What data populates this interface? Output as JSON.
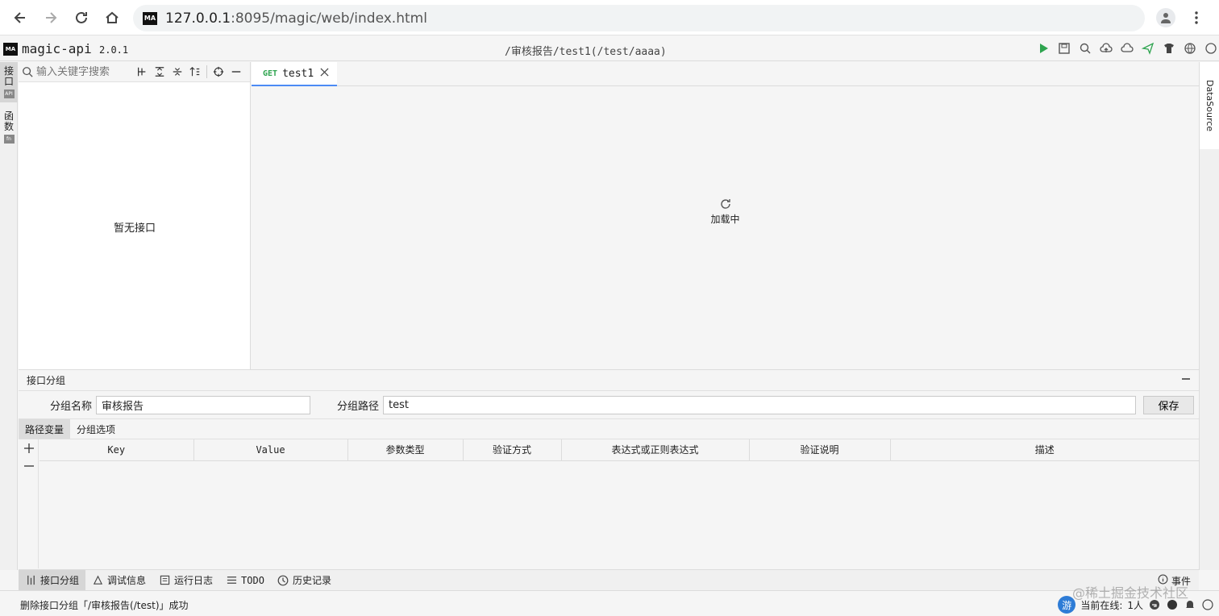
{
  "browser": {
    "url_host": "127.0.0.1",
    "url_rest": ":8095/magic/web/index.html",
    "site_icon_text": "MA"
  },
  "app": {
    "logo_text": "MA",
    "name": "magic-api",
    "version": "2.0.1",
    "breadcrumb": "/审核报告/test1(/test/aaaa)",
    "toolbar_icons": [
      "run-icon",
      "save-icon",
      "search-icon",
      "upload-icon",
      "cloud-push-icon",
      "send-icon",
      "theme-icon",
      "language-icon"
    ]
  },
  "left_tabs": [
    {
      "label": "接口",
      "badge": "API"
    },
    {
      "label": "函数",
      "badge": "fn"
    }
  ],
  "api_panel": {
    "search_placeholder": "输入关键字搜索",
    "empty_text": "暂无接口"
  },
  "editor": {
    "tab": {
      "method": "GET",
      "name": "test1"
    },
    "loading_text": "加载中"
  },
  "right_tabs": [
    {
      "label": "DataSource"
    }
  ],
  "group_panel": {
    "title": "接口分组",
    "name_label": "分组名称",
    "name_value": "审核报告",
    "path_label": "分组路径",
    "path_value": "test",
    "save_label": "保存",
    "sub_tabs": [
      "路径变量",
      "分组选项"
    ],
    "columns": [
      "Key",
      "Value",
      "参数类型",
      "验证方式",
      "表达式或正则表达式",
      "验证说明",
      "描述"
    ]
  },
  "bottom_tabs": [
    {
      "label": "接口分组",
      "icon": "group-icon"
    },
    {
      "label": "调试信息",
      "icon": "bug-icon"
    },
    {
      "label": "运行日志",
      "icon": "log-icon"
    },
    {
      "label": "TODO",
      "icon": "list-icon"
    },
    {
      "label": "历史记录",
      "icon": "history-icon"
    }
  ],
  "events_label": "事件",
  "status": {
    "message": "删除接口分组「/审核报告(/test)」成功",
    "visitor_badge": "游",
    "online_label": "当前在线:",
    "online_count": "1人"
  },
  "watermark": "@稀土掘金技术社区"
}
